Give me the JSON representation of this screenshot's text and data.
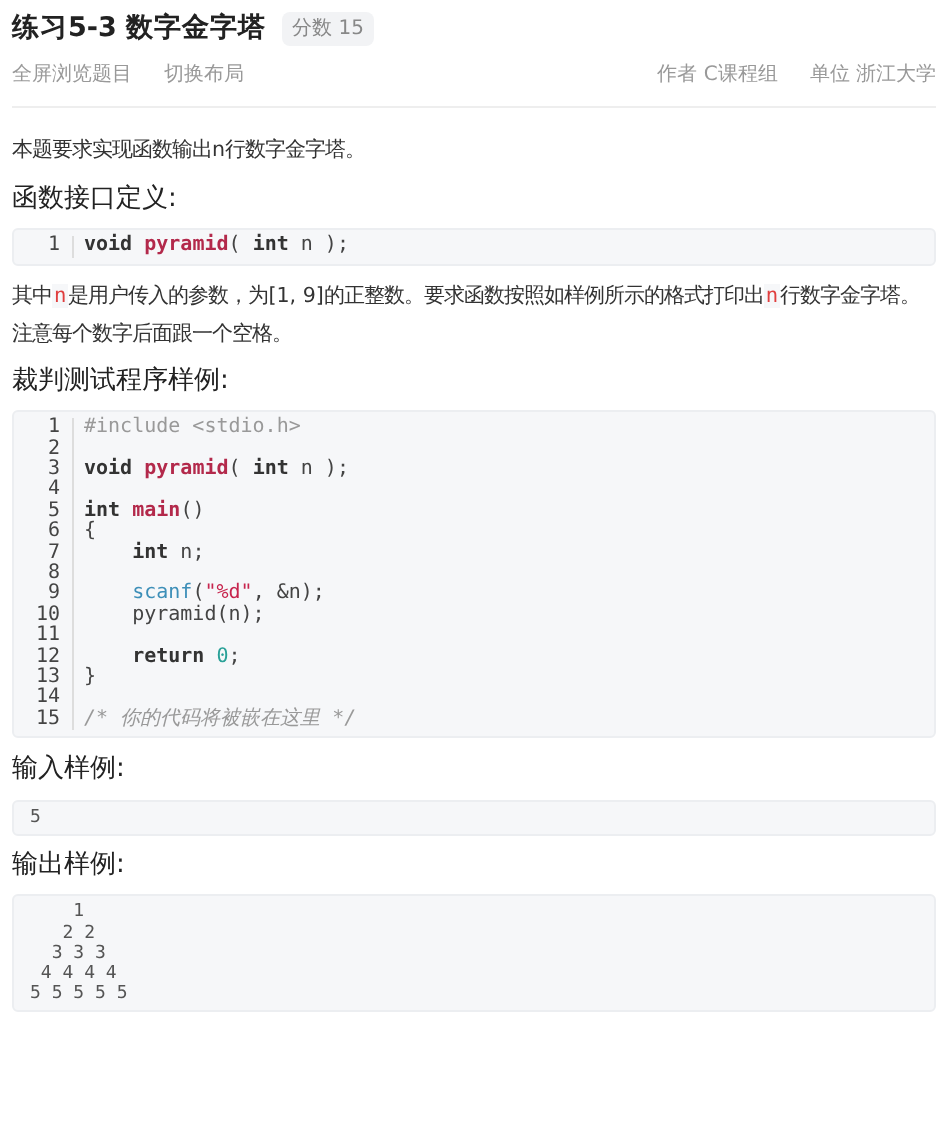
{
  "title": "练习5-3 数字金字塔",
  "score_badge": "分数 15",
  "toolbar": {
    "links": [
      "全屏浏览题目",
      "切换布局"
    ],
    "meta": [
      {
        "label": "作者",
        "value": "C课程组"
      },
      {
        "label": "单位",
        "value": "浙江大学"
      }
    ]
  },
  "intro": "本题要求实现函数输出n行数字金字塔。",
  "sections": [
    {
      "heading": "函数接口定义:",
      "kind": "code",
      "lines": [
        {
          "number": "1",
          "tokens": [
            {
              "text": "void ",
              "kind": "keyword"
            },
            {
              "text": "pyramid",
              "kind": "func"
            },
            {
              "text": "( ",
              "kind": "plain"
            },
            {
              "text": "int",
              "kind": "keyword"
            },
            {
              "text": " n );",
              "kind": "plain"
            }
          ]
        }
      ]
    },
    {
      "kind": "paragraph",
      "segments": [
        {
          "text": "其中",
          "kind": "text"
        },
        {
          "text": "n",
          "kind": "code"
        },
        {
          "text": "是用户传入的参数，为[1, 9]的正整数。要求函数按照如样例所示的格式打印出",
          "kind": "text"
        },
        {
          "text": "n",
          "kind": "code"
        },
        {
          "text": "行数字金字塔。注意每个数字后面跟一个空格。",
          "kind": "text"
        }
      ]
    },
    {
      "heading": "裁判测试程序样例:",
      "kind": "code",
      "lines": [
        {
          "number": "1",
          "tokens": [
            {
              "text": "#include <stdio.h>",
              "kind": "preproc"
            }
          ]
        },
        {
          "number": "2"
        },
        {
          "number": "3",
          "tokens": [
            {
              "text": "void ",
              "kind": "keyword"
            },
            {
              "text": "pyramid",
              "kind": "func"
            },
            {
              "text": "( ",
              "kind": "plain"
            },
            {
              "text": "int",
              "kind": "keyword"
            },
            {
              "text": " n );",
              "kind": "plain"
            }
          ]
        },
        {
          "number": "4"
        },
        {
          "number": "5",
          "tokens": [
            {
              "text": "int ",
              "kind": "keyword"
            },
            {
              "text": "main",
              "kind": "func"
            },
            {
              "text": "()",
              "kind": "plain"
            }
          ]
        },
        {
          "number": "6",
          "tokens": [
            {
              "text": "{",
              "kind": "plain"
            }
          ]
        },
        {
          "number": "7",
          "tokens": [
            {
              "text": "    int",
              "kind": "keyword"
            },
            {
              "text": " n;",
              "kind": "plain"
            }
          ]
        },
        {
          "number": "8"
        },
        {
          "number": "9",
          "tokens": [
            {
              "text": "    scanf",
              "kind": "builtin"
            },
            {
              "text": "(",
              "kind": "plain"
            },
            {
              "text": "\"%d\"",
              "kind": "string"
            },
            {
              "text": ", &n);",
              "kind": "plain"
            }
          ]
        },
        {
          "number": "10",
          "tokens": [
            {
              "text": "    pyramid(n);",
              "kind": "plain"
            }
          ]
        },
        {
          "number": "11"
        },
        {
          "number": "12",
          "tokens": [
            {
              "text": "    return ",
              "kind": "keyword"
            },
            {
              "text": "0",
              "kind": "number"
            },
            {
              "text": ";",
              "kind": "plain"
            }
          ]
        },
        {
          "number": "13",
          "tokens": [
            {
              "text": "}",
              "kind": "plain"
            }
          ]
        },
        {
          "number": "14"
        },
        {
          "number": "15",
          "tokens": [
            {
              "text": "/* 你的代码将被嵌在这里 */",
              "kind": "comment"
            }
          ]
        }
      ]
    },
    {
      "heading": "输入样例:",
      "kind": "sample",
      "lines": [
        "5"
      ]
    },
    {
      "heading": "输出样例:",
      "kind": "sample",
      "lines": [
        "    1",
        "   2 2",
        "  3 3 3",
        " 4 4 4 4",
        "5 5 5 5 5"
      ]
    }
  ]
}
